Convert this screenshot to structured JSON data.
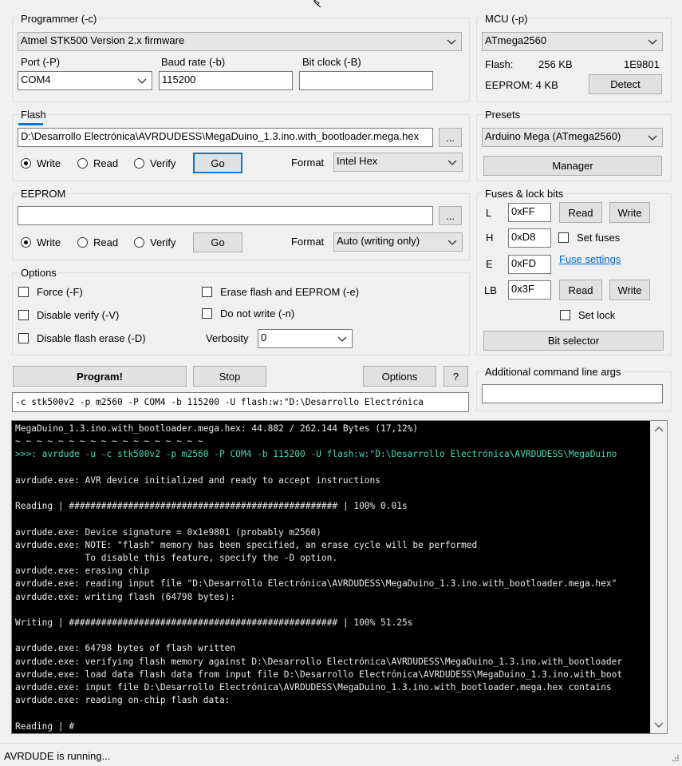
{
  "programmer": {
    "group_label": "Programmer (-c)",
    "selected": "Atmel STK500 Version 2.x firmware",
    "port_label": "Port (-P)",
    "port_value": "COM4",
    "baud_label": "Baud rate (-b)",
    "baud_value": "115200",
    "bitclock_label": "Bit clock (-B)",
    "bitclock_value": ""
  },
  "mcu": {
    "group_label": "MCU (-p)",
    "selected": "ATmega2560",
    "flash_label": "Flash:",
    "flash_size": "256 KB",
    "signature": "1E9801",
    "eeprom_label": "EEPROM: 4 KB",
    "detect_label": "Detect"
  },
  "flash": {
    "group_label": "Flash",
    "file": "D:\\Desarrollo Electrónica\\AVRDUDESS\\MegaDuino_1.3.ino.with_bootloader.mega.hex",
    "browse_label": "...",
    "progress_fraction": 0.06,
    "modes": [
      "Write",
      "Read",
      "Verify"
    ],
    "selected_mode": "Write",
    "go_label": "Go",
    "format_label": "Format",
    "format_value": "Intel Hex"
  },
  "eeprom": {
    "group_label": "EEPROM",
    "file": "",
    "browse_label": "...",
    "modes": [
      "Write",
      "Read",
      "Verify"
    ],
    "selected_mode": "Write",
    "go_label": "Go",
    "format_label": "Format",
    "format_value": "Auto (writing only)"
  },
  "presets": {
    "group_label": "Presets",
    "selected": "Arduino Mega (ATmega2560)",
    "manager_label": "Manager"
  },
  "fuses": {
    "group_label": "Fuses & lock bits",
    "L_label": "L",
    "L_value": "0xFF",
    "H_label": "H",
    "H_value": "0xD8",
    "E_label": "E",
    "E_value": "0xFD",
    "LB_label": "LB",
    "LB_value": "0x3F",
    "read_label": "Read",
    "write_label": "Write",
    "set_fuses_label": "Set fuses",
    "fuse_settings_link": "Fuse settings",
    "set_lock_label": "Set lock",
    "bit_selector_label": "Bit selector"
  },
  "options": {
    "group_label": "Options",
    "force_label": "Force (-F)",
    "disable_verify_label": "Disable verify (-V)",
    "disable_flash_erase_label": "Disable flash erase (-D)",
    "erase_label": "Erase flash and EEPROM (-e)",
    "do_not_write_label": "Do not write (-n)",
    "verbosity_label": "Verbosity",
    "verbosity_value": "0"
  },
  "actions": {
    "program_label": "Program!",
    "stop_label": "Stop",
    "options_label": "Options",
    "help_label": "?"
  },
  "additional_args": {
    "label": "Additional command line args",
    "value": ""
  },
  "command_line": "-c stk500v2 -p m2560 -P COM4 -b 115200 -U flash:w:\"D:\\Desarrollo Electrónica",
  "console": {
    "lines": [
      "MegaDuino_1.3.ino.with_bootloader.mega.hex: 44.882 / 262.144 Bytes (17,12%)",
      "~ ~ ~ ~ ~ ~ ~ ~ ~ ~ ~ ~ ~ ~ ~ ~ ~ ~",
      ">>>: avrdude -u -c stk500v2 -p m2560 -P COM4 -b 115200 -U flash:w:\"D:\\Desarrollo Electrónica\\AVRDUDESS\\MegaDuino",
      "",
      "avrdude.exe: AVR device initialized and ready to accept instructions",
      "",
      "Reading | ################################################## | 100% 0.01s",
      "",
      "avrdude.exe: Device signature = 0x1e9801 (probably m2560)",
      "avrdude.exe: NOTE: \"flash\" memory has been specified, an erase cycle will be performed",
      "             To disable this feature, specify the -D option.",
      "avrdude.exe: erasing chip",
      "avrdude.exe: reading input file \"D:\\Desarrollo Electrónica\\AVRDUDESS\\MegaDuino_1.3.ino.with_bootloader.mega.hex\"",
      "avrdude.exe: writing flash (64798 bytes):",
      "",
      "Writing | ################################################## | 100% 51.25s",
      "",
      "avrdude.exe: 64798 bytes of flash written",
      "avrdude.exe: verifying flash memory against D:\\Desarrollo Electrónica\\AVRDUDESS\\MegaDuino_1.3.ino.with_bootloader",
      "avrdude.exe: load data flash data from input file D:\\Desarrollo Electrónica\\AVRDUDESS\\MegaDuino_1.3.ino.with_boot",
      "avrdude.exe: input file D:\\Desarrollo Electrónica\\AVRDUDESS\\MegaDuino_1.3.ino.with_bootloader.mega.hex contains",
      "avrdude.exe: reading on-chip flash data:",
      "",
      "Reading | #"
    ]
  },
  "status_text": "AVRDUDE is running...",
  "colors": {
    "accent": "#0078d7",
    "link": "#0066cc",
    "console_bg": "#000000",
    "console_text": "#e8e8e8",
    "console_command": "#3fd8b8"
  },
  "icons": [
    "chevron-down-icon",
    "scroll-up-icon",
    "scroll-down-icon",
    "resize-grip-icon",
    "mouse-cursor-icon"
  ]
}
